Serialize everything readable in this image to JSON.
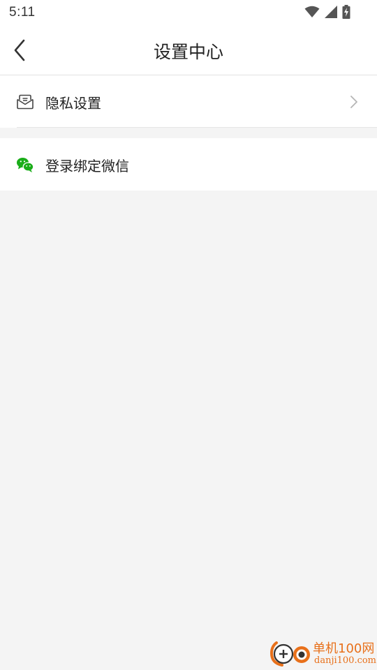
{
  "status_bar": {
    "time": "5:11",
    "icons": [
      "wifi-icon",
      "cellular-signal-icon",
      "battery-charging-icon"
    ]
  },
  "header": {
    "title": "设置中心",
    "back_icon": "chevron-left-icon"
  },
  "settings": {
    "items": [
      {
        "label": "隐私设置",
        "icon": "privacy-envelope-icon",
        "has_chevron": true
      },
      {
        "label": "登录绑定微信",
        "icon": "wechat-icon",
        "has_chevron": false
      }
    ]
  },
  "watermark": {
    "name": "单机100网",
    "url": "danji100.com"
  },
  "colors": {
    "background": "#f4f4f4",
    "surface": "#ffffff",
    "wechat_green": "#1aad19",
    "watermark_orange": "#e8701a"
  }
}
